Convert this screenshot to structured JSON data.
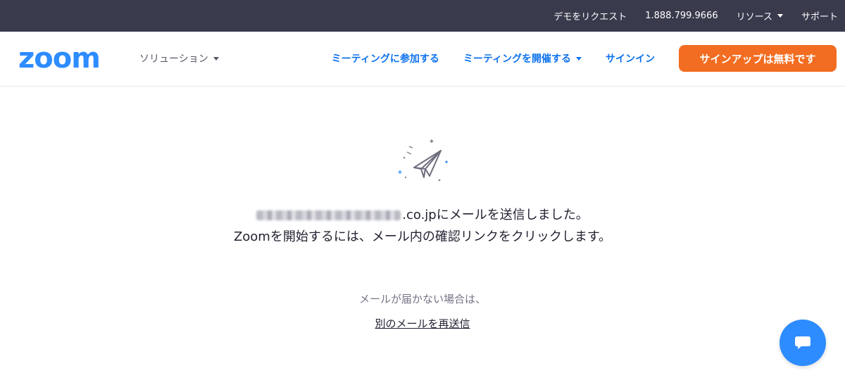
{
  "topbar": {
    "request_demo": "デモをリクエスト",
    "phone": "1.888.799.9666",
    "resources": "リソース",
    "support": "サポート",
    "background_color": "#393b4d"
  },
  "navbar": {
    "logo_text": "zoom",
    "solutions": "ソリューション",
    "join_meeting": "ミーティングに参加する",
    "host_meeting": "ミーティングを開催する",
    "sign_in": "サインイン",
    "sign_up": "サインアップは無料です",
    "link_color": "#0e72ed",
    "signup_color": "#f26d21",
    "logo_color": "#2d8cff"
  },
  "main": {
    "icon": "paper-plane-icon",
    "email_domain": ".co.jp",
    "sent_suffix": "にメールを送信しました。",
    "instruction": "Zoomを開始するには、メール内の確認リンクをクリックします。",
    "not_received": "メールが届かない場合は、",
    "resend_link": "別のメールを再送信"
  },
  "chat": {
    "icon": "chat-bubble-icon",
    "color": "#2d8cff"
  }
}
